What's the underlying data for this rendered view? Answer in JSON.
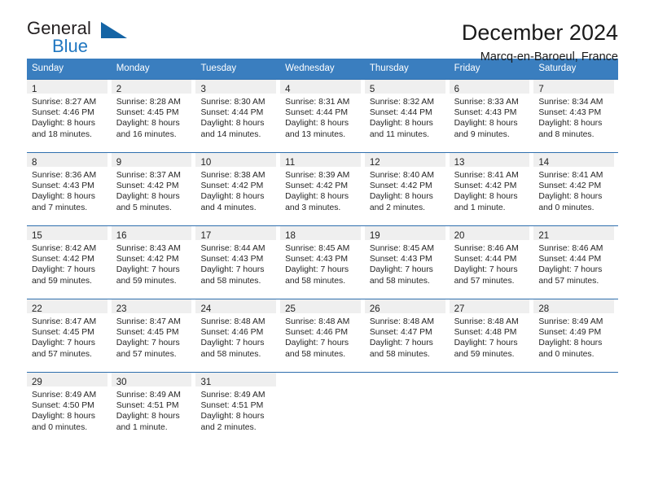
{
  "logo": {
    "word1": "General",
    "word2": "Blue",
    "triangle_color": "#1464a5",
    "blue_color": "#2077c1"
  },
  "header": {
    "title": "December 2024",
    "subtitle": "Marcq-en-Baroeul, France"
  },
  "colors": {
    "header_row": "#3a7ebf",
    "cell_band": "#efefef",
    "separator": "#2f6fae"
  },
  "weekdays": [
    "Sunday",
    "Monday",
    "Tuesday",
    "Wednesday",
    "Thursday",
    "Friday",
    "Saturday"
  ],
  "weeks": [
    [
      {
        "day": "1",
        "sunrise": "Sunrise: 8:27 AM",
        "sunset": "Sunset: 4:46 PM",
        "daylight1": "Daylight: 8 hours",
        "daylight2": "and 18 minutes."
      },
      {
        "day": "2",
        "sunrise": "Sunrise: 8:28 AM",
        "sunset": "Sunset: 4:45 PM",
        "daylight1": "Daylight: 8 hours",
        "daylight2": "and 16 minutes."
      },
      {
        "day": "3",
        "sunrise": "Sunrise: 8:30 AM",
        "sunset": "Sunset: 4:44 PM",
        "daylight1": "Daylight: 8 hours",
        "daylight2": "and 14 minutes."
      },
      {
        "day": "4",
        "sunrise": "Sunrise: 8:31 AM",
        "sunset": "Sunset: 4:44 PM",
        "daylight1": "Daylight: 8 hours",
        "daylight2": "and 13 minutes."
      },
      {
        "day": "5",
        "sunrise": "Sunrise: 8:32 AM",
        "sunset": "Sunset: 4:44 PM",
        "daylight1": "Daylight: 8 hours",
        "daylight2": "and 11 minutes."
      },
      {
        "day": "6",
        "sunrise": "Sunrise: 8:33 AM",
        "sunset": "Sunset: 4:43 PM",
        "daylight1": "Daylight: 8 hours",
        "daylight2": "and 9 minutes."
      },
      {
        "day": "7",
        "sunrise": "Sunrise: 8:34 AM",
        "sunset": "Sunset: 4:43 PM",
        "daylight1": "Daylight: 8 hours",
        "daylight2": "and 8 minutes."
      }
    ],
    [
      {
        "day": "8",
        "sunrise": "Sunrise: 8:36 AM",
        "sunset": "Sunset: 4:43 PM",
        "daylight1": "Daylight: 8 hours",
        "daylight2": "and 7 minutes."
      },
      {
        "day": "9",
        "sunrise": "Sunrise: 8:37 AM",
        "sunset": "Sunset: 4:42 PM",
        "daylight1": "Daylight: 8 hours",
        "daylight2": "and 5 minutes."
      },
      {
        "day": "10",
        "sunrise": "Sunrise: 8:38 AM",
        "sunset": "Sunset: 4:42 PM",
        "daylight1": "Daylight: 8 hours",
        "daylight2": "and 4 minutes."
      },
      {
        "day": "11",
        "sunrise": "Sunrise: 8:39 AM",
        "sunset": "Sunset: 4:42 PM",
        "daylight1": "Daylight: 8 hours",
        "daylight2": "and 3 minutes."
      },
      {
        "day": "12",
        "sunrise": "Sunrise: 8:40 AM",
        "sunset": "Sunset: 4:42 PM",
        "daylight1": "Daylight: 8 hours",
        "daylight2": "and 2 minutes."
      },
      {
        "day": "13",
        "sunrise": "Sunrise: 8:41 AM",
        "sunset": "Sunset: 4:42 PM",
        "daylight1": "Daylight: 8 hours",
        "daylight2": "and 1 minute."
      },
      {
        "day": "14",
        "sunrise": "Sunrise: 8:41 AM",
        "sunset": "Sunset: 4:42 PM",
        "daylight1": "Daylight: 8 hours",
        "daylight2": "and 0 minutes."
      }
    ],
    [
      {
        "day": "15",
        "sunrise": "Sunrise: 8:42 AM",
        "sunset": "Sunset: 4:42 PM",
        "daylight1": "Daylight: 7 hours",
        "daylight2": "and 59 minutes."
      },
      {
        "day": "16",
        "sunrise": "Sunrise: 8:43 AM",
        "sunset": "Sunset: 4:42 PM",
        "daylight1": "Daylight: 7 hours",
        "daylight2": "and 59 minutes."
      },
      {
        "day": "17",
        "sunrise": "Sunrise: 8:44 AM",
        "sunset": "Sunset: 4:43 PM",
        "daylight1": "Daylight: 7 hours",
        "daylight2": "and 58 minutes."
      },
      {
        "day": "18",
        "sunrise": "Sunrise: 8:45 AM",
        "sunset": "Sunset: 4:43 PM",
        "daylight1": "Daylight: 7 hours",
        "daylight2": "and 58 minutes."
      },
      {
        "day": "19",
        "sunrise": "Sunrise: 8:45 AM",
        "sunset": "Sunset: 4:43 PM",
        "daylight1": "Daylight: 7 hours",
        "daylight2": "and 58 minutes."
      },
      {
        "day": "20",
        "sunrise": "Sunrise: 8:46 AM",
        "sunset": "Sunset: 4:44 PM",
        "daylight1": "Daylight: 7 hours",
        "daylight2": "and 57 minutes."
      },
      {
        "day": "21",
        "sunrise": "Sunrise: 8:46 AM",
        "sunset": "Sunset: 4:44 PM",
        "daylight1": "Daylight: 7 hours",
        "daylight2": "and 57 minutes."
      }
    ],
    [
      {
        "day": "22",
        "sunrise": "Sunrise: 8:47 AM",
        "sunset": "Sunset: 4:45 PM",
        "daylight1": "Daylight: 7 hours",
        "daylight2": "and 57 minutes."
      },
      {
        "day": "23",
        "sunrise": "Sunrise: 8:47 AM",
        "sunset": "Sunset: 4:45 PM",
        "daylight1": "Daylight: 7 hours",
        "daylight2": "and 57 minutes."
      },
      {
        "day": "24",
        "sunrise": "Sunrise: 8:48 AM",
        "sunset": "Sunset: 4:46 PM",
        "daylight1": "Daylight: 7 hours",
        "daylight2": "and 58 minutes."
      },
      {
        "day": "25",
        "sunrise": "Sunrise: 8:48 AM",
        "sunset": "Sunset: 4:46 PM",
        "daylight1": "Daylight: 7 hours",
        "daylight2": "and 58 minutes."
      },
      {
        "day": "26",
        "sunrise": "Sunrise: 8:48 AM",
        "sunset": "Sunset: 4:47 PM",
        "daylight1": "Daylight: 7 hours",
        "daylight2": "and 58 minutes."
      },
      {
        "day": "27",
        "sunrise": "Sunrise: 8:48 AM",
        "sunset": "Sunset: 4:48 PM",
        "daylight1": "Daylight: 7 hours",
        "daylight2": "and 59 minutes."
      },
      {
        "day": "28",
        "sunrise": "Sunrise: 8:49 AM",
        "sunset": "Sunset: 4:49 PM",
        "daylight1": "Daylight: 8 hours",
        "daylight2": "and 0 minutes."
      }
    ],
    [
      {
        "day": "29",
        "sunrise": "Sunrise: 8:49 AM",
        "sunset": "Sunset: 4:50 PM",
        "daylight1": "Daylight: 8 hours",
        "daylight2": "and 0 minutes."
      },
      {
        "day": "30",
        "sunrise": "Sunrise: 8:49 AM",
        "sunset": "Sunset: 4:51 PM",
        "daylight1": "Daylight: 8 hours",
        "daylight2": "and 1 minute."
      },
      {
        "day": "31",
        "sunrise": "Sunrise: 8:49 AM",
        "sunset": "Sunset: 4:51 PM",
        "daylight1": "Daylight: 8 hours",
        "daylight2": "and 2 minutes."
      },
      {
        "day": "",
        "sunrise": "",
        "sunset": "",
        "daylight1": "",
        "daylight2": ""
      },
      {
        "day": "",
        "sunrise": "",
        "sunset": "",
        "daylight1": "",
        "daylight2": ""
      },
      {
        "day": "",
        "sunrise": "",
        "sunset": "",
        "daylight1": "",
        "daylight2": ""
      },
      {
        "day": "",
        "sunrise": "",
        "sunset": "",
        "daylight1": "",
        "daylight2": ""
      }
    ]
  ]
}
